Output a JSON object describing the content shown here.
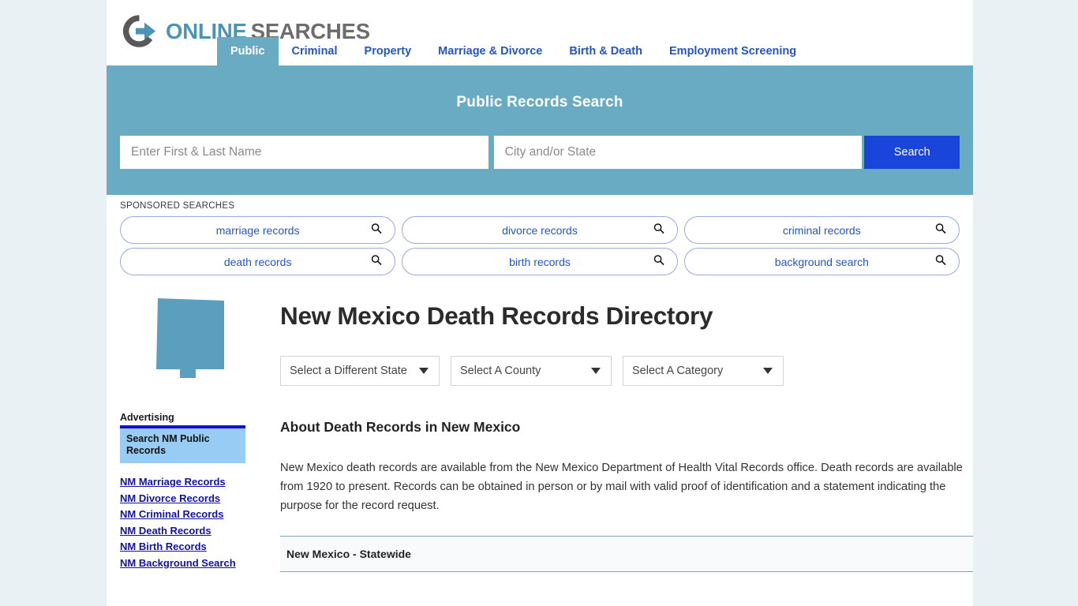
{
  "brand": {
    "name_part1": "ONLINE",
    "name_part2": "SEARCHES",
    "logo_icon": "circle-arrow-right-icon",
    "accent_blue": "#4a94b8",
    "accent_gray": "#6d6d6d"
  },
  "nav": {
    "tabs": [
      {
        "label": "Public",
        "active": true
      },
      {
        "label": "Criminal",
        "active": false
      },
      {
        "label": "Property",
        "active": false
      },
      {
        "label": "Marriage & Divorce",
        "active": false
      },
      {
        "label": "Birth & Death",
        "active": false
      },
      {
        "label": "Employment Screening",
        "active": false
      }
    ],
    "active_bg": "#6aabc4",
    "link_color": "#2255cc"
  },
  "hero": {
    "title": "Public Records Search",
    "background": "#6aabc4",
    "name_placeholder": "Enter First & Last Name",
    "name_value": "",
    "city_placeholder": "City and/or State",
    "city_value": "",
    "search_label": "Search",
    "search_button_color": "#1a45db"
  },
  "sponsored": {
    "label": "SPONSORED SEARCHES",
    "icon": "magnifier-icon",
    "rows": [
      [
        "marriage records",
        "divorce records",
        "criminal records"
      ],
      [
        "death records",
        "birth records",
        "background search"
      ]
    ]
  },
  "sidebar": {
    "state_shape": "new-mexico-map-icon",
    "state_shape_color": "#5b9ebd",
    "advertising_label": "Advertising",
    "ad_title": "Search NM Public Records",
    "links": [
      "NM Marriage Records",
      "NM Divorce Records",
      "NM Criminal Records",
      "NM Death Records",
      "NM Birth Records",
      "NM Background Search"
    ]
  },
  "main": {
    "title": "New Mexico Death Records Directory",
    "selects": [
      {
        "label": "Select a Different State"
      },
      {
        "label": "Select A County"
      },
      {
        "label": "Select A Category"
      }
    ],
    "about_heading": "About Death Records in New Mexico",
    "about_text": "New Mexico death records are available from the New Mexico Department of Health Vital Records office. Death records are available from 1920 to present. Records can be obtained in person or by mail with valid proof of identification and a statement indicating the purpose for the record request.",
    "table_rows": [
      "New Mexico - Statewide"
    ]
  }
}
